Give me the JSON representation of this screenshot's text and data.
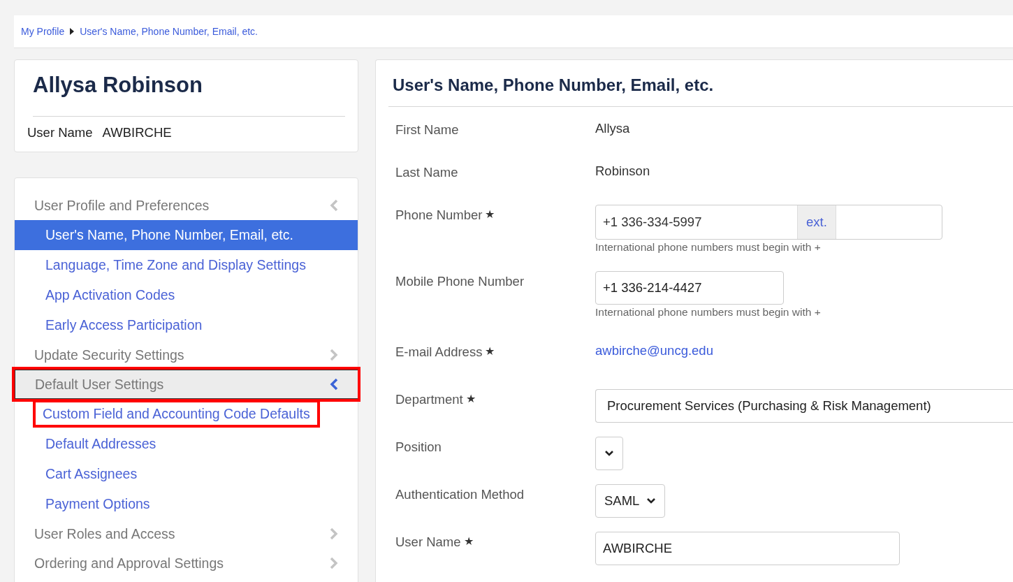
{
  "breadcrumb": [
    {
      "label": "My Profile"
    },
    {
      "label": "User's Name, Phone Number, Email, etc."
    }
  ],
  "profile": {
    "name": "Allysa Robinson",
    "user_name_label": "User Name",
    "user_name": "AWBIRCHE"
  },
  "nav": [
    {
      "label": "User Profile and Preferences",
      "expanded": true,
      "hovered": false,
      "highlighted": false,
      "children": [
        {
          "label": "User's Name, Phone Number, Email, etc.",
          "selected": true,
          "highlighted": false
        },
        {
          "label": "Language, Time Zone and Display Settings",
          "selected": false,
          "highlighted": false
        },
        {
          "label": "App Activation Codes",
          "selected": false,
          "highlighted": false
        },
        {
          "label": "Early Access Participation",
          "selected": false,
          "highlighted": false
        }
      ]
    },
    {
      "label": "Update Security Settings",
      "expanded": false,
      "hovered": false,
      "highlighted": false
    },
    {
      "label": "Default User Settings",
      "expanded": true,
      "hovered": true,
      "highlighted": true,
      "children": [
        {
          "label": "Custom Field and Accounting Code Defaults",
          "selected": false,
          "highlighted": true
        },
        {
          "label": "Default Addresses",
          "selected": false,
          "highlighted": false
        },
        {
          "label": "Cart Assignees",
          "selected": false,
          "highlighted": false
        },
        {
          "label": "Payment Options",
          "selected": false,
          "highlighted": false
        }
      ]
    },
    {
      "label": "User Roles and Access",
      "expanded": false,
      "hovered": false,
      "highlighted": false
    },
    {
      "label": "Ordering and Approval Settings",
      "expanded": false,
      "hovered": false,
      "highlighted": false
    }
  ],
  "panel": {
    "title": "User's Name, Phone Number, Email, etc.",
    "fields": [
      {
        "kind": "text",
        "label": "First Name",
        "value": "Allysa"
      },
      {
        "kind": "text",
        "label": "Last Name",
        "value": "Robinson"
      },
      {
        "kind": "phone",
        "label": "Phone Number",
        "required_mark": "★",
        "value": "+1 336-334-5997",
        "ext_label": "ext.",
        "hint": "International phone numbers must begin with +"
      },
      {
        "kind": "input",
        "label": "Mobile Phone Number",
        "value": "+1 336-214-4427",
        "hint": "International phone numbers must begin with +"
      },
      {
        "kind": "link",
        "label": "E-mail Address",
        "required_mark": "★",
        "value": "awbirche@uncg.edu"
      },
      {
        "kind": "combo",
        "label": "Department",
        "required_mark": "★",
        "value": "Procurement Services (Purchasing & Risk Management)"
      },
      {
        "kind": "select",
        "label": "Position"
      },
      {
        "kind": "select",
        "label": "Authentication Method",
        "value": "SAML"
      },
      {
        "kind": "longinput",
        "label": "User Name",
        "required_mark": "★",
        "value": "AWBIRCHE"
      }
    ]
  }
}
